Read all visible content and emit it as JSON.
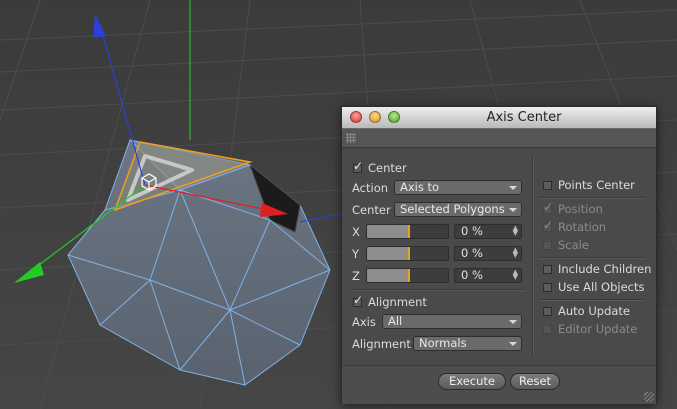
{
  "dialog": {
    "title": "Axis Center",
    "center": {
      "checked": true,
      "label": "Center",
      "action_label": "Action",
      "action_value": "Axis to",
      "center_label": "Center",
      "center_value": "Selected Polygons",
      "axes": [
        {
          "label": "X",
          "value": "0 %"
        },
        {
          "label": "Y",
          "value": "0 %"
        },
        {
          "label": "Z",
          "value": "0 %"
        }
      ]
    },
    "alignment": {
      "checked": true,
      "label": "Alignment",
      "axis_label": "Axis",
      "axis_value": "All",
      "alignment_label": "Alignment",
      "alignment_value": "Normals"
    },
    "options": {
      "points_center": {
        "label": "Points Center",
        "checked": false,
        "enabled": true
      },
      "position": {
        "label": "Position",
        "checked": true,
        "enabled": false
      },
      "rotation": {
        "label": "Rotation",
        "checked": true,
        "enabled": false
      },
      "scale": {
        "label": "Scale",
        "checked": false,
        "enabled": false
      },
      "include_children": {
        "label": "Include Children",
        "checked": false,
        "enabled": true
      },
      "use_all_objects": {
        "label": "Use All Objects",
        "checked": false,
        "enabled": true
      },
      "auto_update": {
        "label": "Auto Update",
        "checked": false,
        "enabled": true
      },
      "editor_update": {
        "label": "Editor Update",
        "checked": false,
        "enabled": false
      }
    },
    "buttons": {
      "execute": "Execute",
      "reset": "Reset"
    }
  },
  "colors": {
    "background": "#3a3a3a",
    "dialog_bg": "#4d4d4d",
    "axis_x": "#e02020",
    "axis_y": "#22cc22",
    "axis_z": "#2a3fdd",
    "selection": "#f0a020",
    "slider_marker": "#e6a21c"
  }
}
